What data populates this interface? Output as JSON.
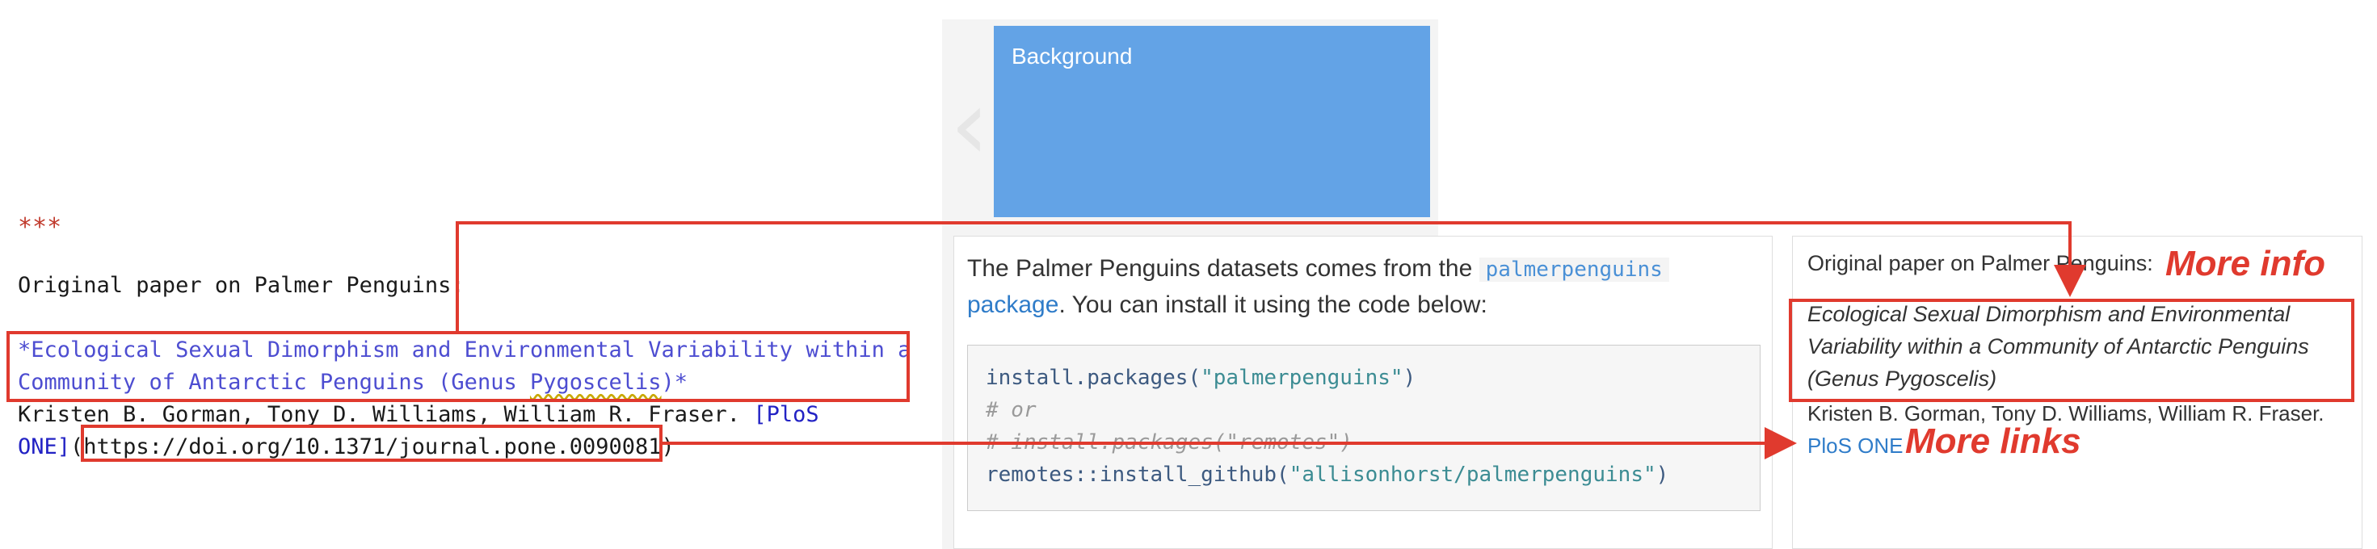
{
  "editor": {
    "hr": "***",
    "heading": "Original paper on Palmer Penguins:",
    "italic_line1": "*Ecological Sexual Dimorphism and Environmental Variability within a",
    "italic_line2_pre": "Community of Antarctic Penguins (Genus ",
    "italic_line2_word": "Pygoscelis",
    "italic_line2_post": ")*",
    "authors_pre": "Kristen B. Gorman, Tony D. Williams, William R. Fraser. ",
    "link_text_a": "[PloS",
    "link_text_b": "ONE]",
    "url_open": "(",
    "url": "https://doi.org/10.1371/journal.pone.0090081",
    "url_close": ")"
  },
  "slide": {
    "box_title": "Background",
    "chevron": "‹",
    "intro_pre": "The Palmer Penguins datasets comes from the ",
    "package_code": "palmerpenguins",
    "package_link": "package",
    "intro_post": ". You can install it using the code below:",
    "code": {
      "line1_fn": "install.packages(",
      "line1_str": "\"palmerpenguins\"",
      "line1_end": ")",
      "line2": "# or",
      "line3": "# install.packages(\"remotes\")",
      "line4_fn": "remotes::install_github(",
      "line4_str": "\"allisonhorst/palmerpenguins\"",
      "line4_end": ")"
    }
  },
  "preview": {
    "title": "Original paper on Palmer Penguins:",
    "italic": "Ecological Sexual Dimorphism and Environmental Variability within a Community of Antarctic Penguins (Genus Pygoscelis)",
    "authors": "Kristen B. Gorman, Tony D. Williams, William R. Fraser.",
    "link": "PloS ONE"
  },
  "annotations": {
    "more_info": "More info",
    "more_links": "More links"
  },
  "colors": {
    "annotation": "#e03a2e",
    "box_blue": "#63a3e6",
    "link_blue": "#2f7cc9"
  }
}
